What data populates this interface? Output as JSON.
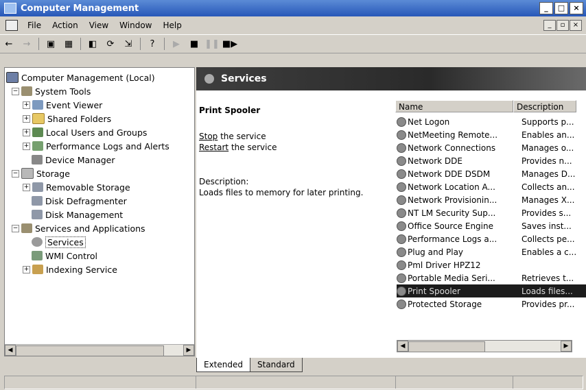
{
  "window": {
    "title": "Computer Management"
  },
  "menu": [
    "File",
    "Action",
    "View",
    "Window",
    "Help"
  ],
  "tree": {
    "root": "Computer Management (Local)",
    "items": [
      {
        "label": "System Tools"
      },
      {
        "label": "Event Viewer"
      },
      {
        "label": "Shared Folders"
      },
      {
        "label": "Local Users and Groups"
      },
      {
        "label": "Performance Logs and Alerts"
      },
      {
        "label": "Device Manager"
      },
      {
        "label": "Storage"
      },
      {
        "label": "Removable Storage"
      },
      {
        "label": "Disk Defragmenter"
      },
      {
        "label": "Disk Management"
      },
      {
        "label": "Services and Applications"
      },
      {
        "label": "Services"
      },
      {
        "label": "WMI Control"
      },
      {
        "label": "Indexing Service"
      }
    ]
  },
  "header": {
    "title": "Services"
  },
  "details": {
    "service_name": "Print Spooler",
    "stop_link": "Stop",
    "stop_rest": " the service",
    "restart_link": "Restart",
    "restart_rest": " the service",
    "description_label": "Description:",
    "description_text": "Loads files to memory for later printing."
  },
  "list": {
    "columns": [
      "Name",
      "Description"
    ],
    "rows": [
      {
        "name": "Net Logon",
        "desc": "Supports p..."
      },
      {
        "name": "NetMeeting Remote...",
        "desc": "Enables an..."
      },
      {
        "name": "Network Connections",
        "desc": "Manages o..."
      },
      {
        "name": "Network DDE",
        "desc": "Provides n..."
      },
      {
        "name": "Network DDE DSDM",
        "desc": "Manages D..."
      },
      {
        "name": "Network Location A...",
        "desc": "Collects an..."
      },
      {
        "name": "Network Provisionin...",
        "desc": "Manages X..."
      },
      {
        "name": "NT LM Security Sup...",
        "desc": "Provides s..."
      },
      {
        "name": "Office Source Engine",
        "desc": "Saves inst..."
      },
      {
        "name": "Performance Logs a...",
        "desc": "Collects pe..."
      },
      {
        "name": "Plug and Play",
        "desc": "Enables a c..."
      },
      {
        "name": "Pml Driver HPZ12",
        "desc": ""
      },
      {
        "name": "Portable Media Seri...",
        "desc": "Retrieves t..."
      },
      {
        "name": "Print Spooler",
        "desc": "Loads files..."
      },
      {
        "name": "Protected Storage",
        "desc": "Provides pr..."
      }
    ],
    "selected_index": 13
  },
  "tabs": [
    "Extended",
    "Standard"
  ]
}
